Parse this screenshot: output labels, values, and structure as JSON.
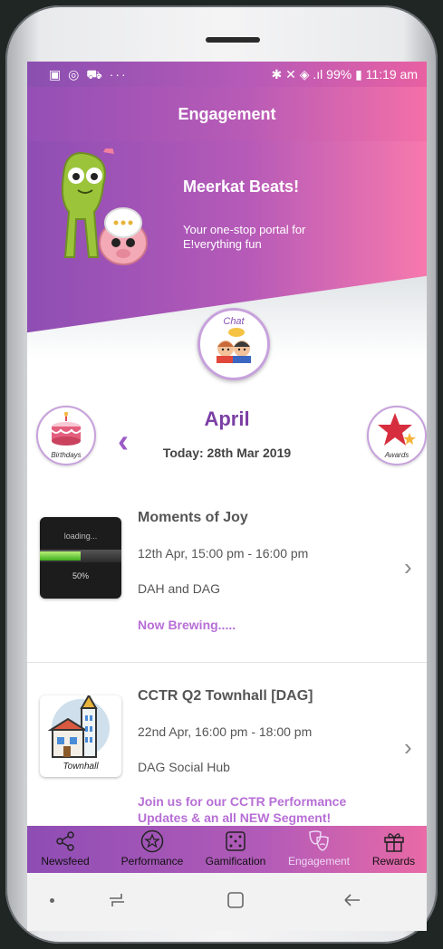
{
  "status": {
    "left_icons": "▣ ◎ ⛟  ···",
    "right": "✱ ✕ ◈ .ıl 99% ▮ 11:19 am"
  },
  "header": {
    "title": "Engagement"
  },
  "banner": {
    "title": "Meerkat Beats!",
    "subtitle": "Your one-stop portal for E!verything fun"
  },
  "chat": {
    "label": "Chat"
  },
  "calendar": {
    "month": "April",
    "today": "Today: 28th Mar 2019",
    "birthdays_label": "Birthdays",
    "awards_label": "Awards"
  },
  "events": [
    {
      "title": "Moments of Joy",
      "time": "12th Apr, 15:00 pm - 16:00 pm",
      "place": "DAH and DAG",
      "tag": "Now Brewing.....",
      "thumb_loading": "loading...",
      "thumb_percent": "50%",
      "progress": 0.5
    },
    {
      "title": "CCTR Q2 Townhall [DAG]",
      "time": "22nd Apr, 16:00 pm - 18:00 pm",
      "place": "DAG Social Hub",
      "tag": "Join us for our CCTR Performance Updates & an all NEW Segment!",
      "thumb_caption": "Townhall"
    }
  ],
  "tabs": [
    {
      "label": "Newsfeed",
      "icon": "share-icon"
    },
    {
      "label": "Performance",
      "icon": "star-badge-icon"
    },
    {
      "label": "Gamification",
      "icon": "dice-icon"
    },
    {
      "label": "Engagement",
      "icon": "masks-icon"
    },
    {
      "label": "Rewards",
      "icon": "gift-icon"
    }
  ],
  "colors": {
    "accent_purple": "#8e4eb4",
    "accent_pink": "#f779ad",
    "month_text": "#7b3fa4",
    "tag_text": "#b76fd6"
  }
}
